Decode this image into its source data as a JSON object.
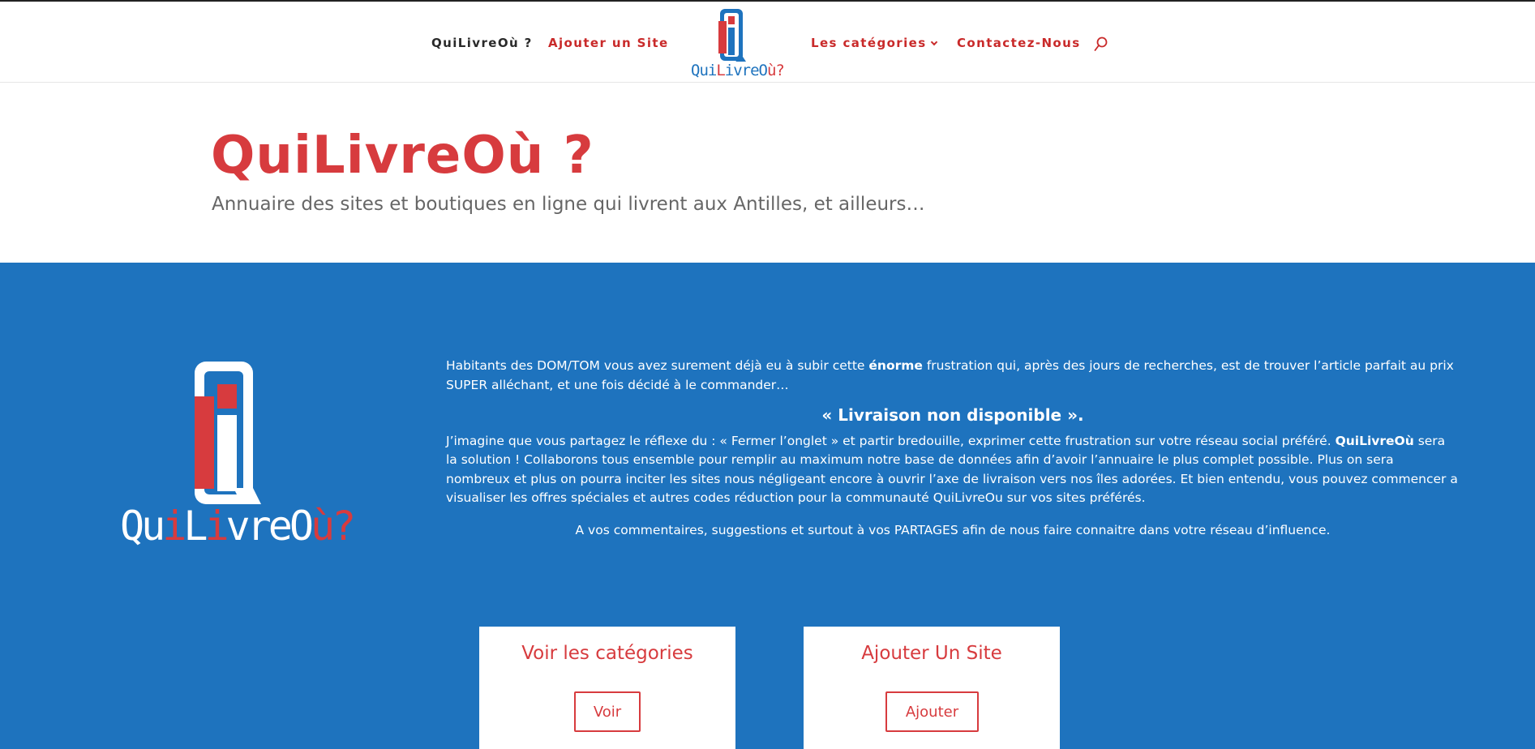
{
  "nav": {
    "left": [
      {
        "label": "QuiLivreOù ?"
      },
      {
        "label": "Ajouter un Site"
      }
    ],
    "right": [
      {
        "label": "Les catégories"
      },
      {
        "label": "Contactez-Nous"
      }
    ],
    "logo_text": {
      "part1": "Qui",
      "part2": "L",
      "part3": "ivreO",
      "part4": "ù?"
    }
  },
  "hero": {
    "title": "QuiLivreOù ?",
    "subtitle": "Annuaire des sites et boutiques en ligne qui livrent aux Antilles, et ailleurs…"
  },
  "intro": {
    "p1_a": "Habitants des DOM/TOM vous avez surement déjà eu à subir cette ",
    "p1_b": "énorme",
    "p1_c": " frustration qui, après des jours de recherches, est de trouver l’article parfait au prix SUPER alléchant, et une fois décidé à le commander…",
    "quote": "« Livraison non disponible ».",
    "p2_a": "J’imagine que vous partagez le réflexe du : « Fermer l’onglet » et partir bredouille, exprimer cette frustration sur votre réseau social préféré. ",
    "p2_b": "QuiLivreOù",
    "p2_c": " sera la solution ! Collaborons tous ensemble pour remplir au maximum notre base de données afin d’avoir l’annuaire le plus complet possible. Plus on sera nombreux et plus on pourra inciter les sites nous négligeant encore à ouvrir l’axe de livraison vers nos îles adorées. Et bien entendu, vous pouvez commencer a visualiser les offres spéciales et autres codes réduction pour la communauté QuiLivreOu sur vos sites préférés.",
    "closing": "A vos commentaires, suggestions et surtout à vos PARTAGES afin de nous faire connaitre dans votre réseau d’influence."
  },
  "big_logo_text": {
    "part1": "Qu",
    "part2": "i",
    "part3": "L",
    "part4": "i",
    "part5": "vreO",
    "part6": "ù?"
  },
  "cards": [
    {
      "title": "Voir les catégories",
      "button": "Voir"
    },
    {
      "title": "Ajouter Un Site",
      "button": "Ajouter"
    }
  ],
  "colors": {
    "brand_red": "#d73b3e",
    "brand_blue": "#1e73be"
  },
  "icons": {
    "search": "search-icon"
  }
}
